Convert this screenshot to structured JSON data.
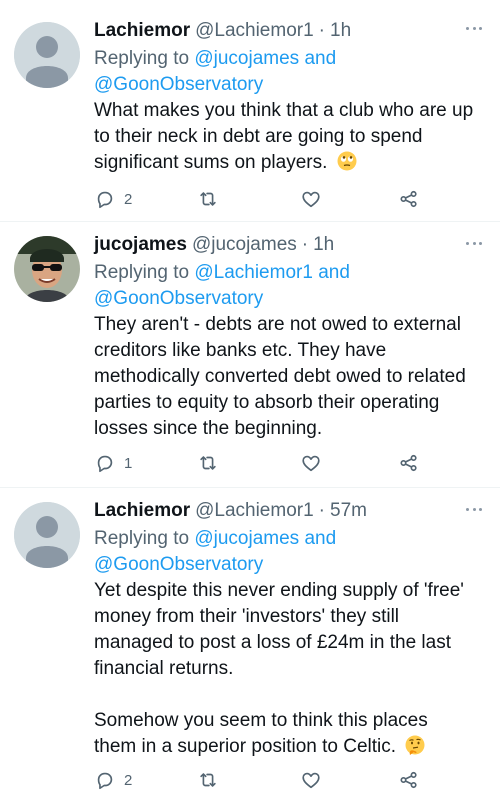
{
  "tweets": [
    {
      "author": "Lachiemor",
      "handle": "@Lachiemor1",
      "separator": "·",
      "time": "1h",
      "reply_prefix": "Replying to",
      "mention_1": "@jucojames",
      "mention_join": "and",
      "mention_2": "@GoonObservatory",
      "text_lines": [
        "What makes you think that a club who are up",
        "to their neck in debt are going to spend",
        "significant sums on players."
      ],
      "trailing_emoji": "rolling-eyes-emoji",
      "avatar": "default-avatar",
      "replies": "2",
      "retweets": "",
      "likes": ""
    },
    {
      "author": "jucojames",
      "handle": "@jucojames",
      "separator": "·",
      "time": "1h",
      "reply_prefix": "Replying to",
      "mention_1": "@Lachiemor1",
      "mention_join": "and",
      "mention_2": "@GoonObservatory",
      "text_lines": [
        "They aren't - debts are not owed to external",
        "creditors like banks etc. They have",
        "methodically converted debt owed to related",
        "parties to equity to absorb their operating",
        "losses since the beginning."
      ],
      "avatar": "profile-photo",
      "replies": "1",
      "retweets": "",
      "likes": ""
    },
    {
      "author": "Lachiemor",
      "handle": "@Lachiemor1",
      "separator": "·",
      "time": "57m",
      "reply_prefix": "Replying to",
      "mention_1": "@jucojames",
      "mention_join": "and",
      "mention_2": "@GoonObservatory",
      "text_lines": [
        "Yet despite this never ending supply of 'free'",
        "money from their 'investors' they still",
        "managed to post a loss of £24m in the last",
        "financial returns."
      ],
      "text_lines_2": [
        "Somehow you seem to think this places",
        "them in a superior position to Celtic."
      ],
      "trailing_emoji": "thinking-face-emoji",
      "avatar": "default-avatar",
      "replies": "2",
      "retweets": "",
      "likes": ""
    }
  ],
  "icons": {
    "reply": "reply-icon",
    "retweet": "retweet-icon",
    "like": "heart-icon",
    "share": "share-icon",
    "more": "more-icon"
  },
  "colors": {
    "mention": "#1d9bf0",
    "secondary_text": "#536471",
    "primary_text": "#0f1419",
    "avatar_default": "#cfd9de"
  }
}
